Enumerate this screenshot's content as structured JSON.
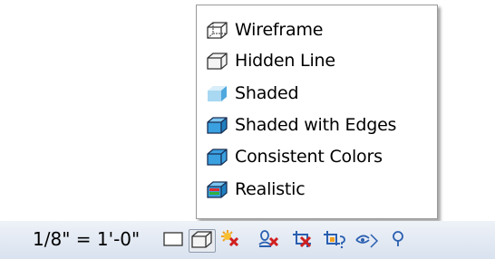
{
  "visual_style_menu": {
    "items": [
      {
        "label": "Wireframe",
        "icon": "wireframe-cube-icon"
      },
      {
        "label": "Hidden Line",
        "icon": "hidden-line-cube-icon"
      },
      {
        "label": "Shaded",
        "icon": "shaded-cube-icon"
      },
      {
        "label": "Shaded with Edges",
        "icon": "shaded-edges-cube-icon"
      },
      {
        "label": "Consistent Colors",
        "icon": "consistent-colors-cube-icon"
      },
      {
        "label": "Realistic",
        "icon": "realistic-cube-icon"
      }
    ]
  },
  "status_bar": {
    "scale": "1/8\" = 1'-0\"",
    "tools": [
      {
        "icon": "detail-level-icon"
      },
      {
        "icon": "visual-style-icon",
        "pressed": true
      },
      {
        "icon": "sun-path-off-icon"
      },
      {
        "icon": "shadows-off-icon"
      },
      {
        "icon": "crop-view-icon"
      },
      {
        "icon": "show-crop-region-icon"
      },
      {
        "icon": "temporary-hide-isolate-icon"
      },
      {
        "icon": "reveal-hidden-elements-icon"
      }
    ]
  },
  "colors": {
    "menu_border": "#9a9a9a",
    "cube_blue": "#3aa0e0",
    "cube_light_blue": "#a8d8f2",
    "status_bar_bg": "#dde5f0",
    "tool_red": "#d02020",
    "tool_blue": "#2a5fb0",
    "tool_orange": "#f0a020"
  }
}
